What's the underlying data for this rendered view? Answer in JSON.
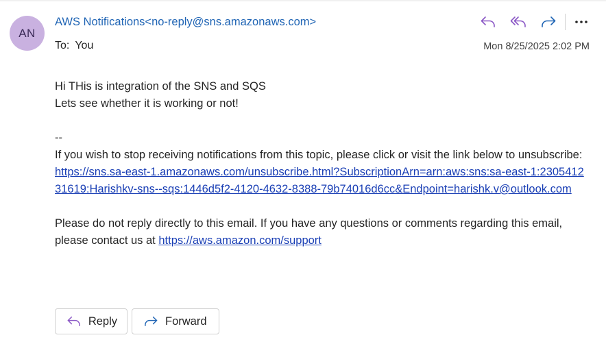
{
  "email": {
    "avatar_initials": "AN",
    "sender": "AWS Notifications<no-reply@sns.amazonaws.com>",
    "to_label": "To:",
    "to_value": "You",
    "date": "Mon 8/25/2025 2:02 PM",
    "body": {
      "line1": "Hi THis is integration of the SNS and SQS",
      "line2": "Lets see whether it is working or not!",
      "separator": "--",
      "unsubscribe_text": "If you wish to stop receiving notifications from this topic, please click or visit the link below to unsubscribe:",
      "unsubscribe_link": "https://sns.sa-east-1.amazonaws.com/unsubscribe.html?SubscriptionArn=arn:aws:sns:sa-east-1:230541231619:Harishkv-sns--sqs:1446d5f2-4120-4632-8388-79b74016d6cc&Endpoint=harishk.v@outlook.com",
      "footer_text": "Please do not reply directly to this email. If you have any questions or comments regarding this email, please contact us at ",
      "support_link": "https://aws.amazon.com/support"
    }
  },
  "buttons": {
    "reply": "Reply",
    "forward": "Forward"
  },
  "icons": {
    "reply": "reply-icon",
    "reply_all": "reply-all-icon",
    "forward": "forward-icon",
    "more": "more-options-icon"
  },
  "colors": {
    "accent_purple": "#8a57c5",
    "accent_blue": "#1f64b4",
    "link": "#1a3fb5",
    "avatar_bg": "#c9b1e0"
  }
}
